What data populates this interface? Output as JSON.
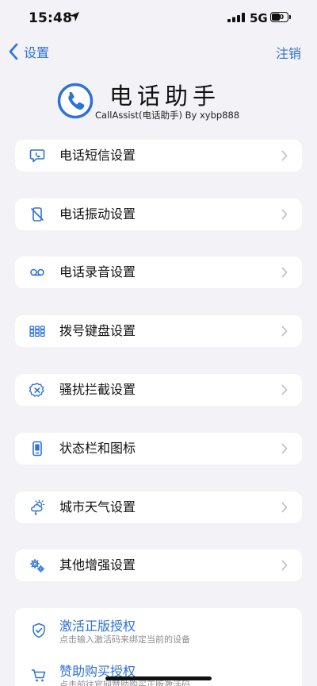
{
  "status_bar": {
    "time": "15:48",
    "network": "5G",
    "battery": "30"
  },
  "nav": {
    "back_label": "设置",
    "right_label": "注销"
  },
  "header": {
    "title": "电话助手",
    "subtitle": "CallAssist(电话助手) By xybp888",
    "icon": "phone-icon"
  },
  "menu": [
    {
      "label": "电话短信设置",
      "icon": "message-icon"
    },
    {
      "label": "电话振动设置",
      "icon": "vibrate-off-icon"
    },
    {
      "label": "电话录音设置",
      "icon": "voicemail-icon"
    },
    {
      "label": "拨号键盘设置",
      "icon": "dialpad-icon"
    },
    {
      "label": "骚扰拦截设置",
      "icon": "block-icon"
    },
    {
      "label": "状态栏和图标",
      "icon": "phone-screen-icon"
    },
    {
      "label": "城市天气设置",
      "icon": "weather-icon"
    },
    {
      "label": "其他增强设置",
      "icon": "gears-icon"
    }
  ],
  "license": [
    {
      "title": "激活正版授权",
      "subtitle": "点击输入激活码来绑定当前的设备",
      "icon": "shield-check-icon"
    },
    {
      "title": "赞助购买授权",
      "subtitle": "点击前往官网赞助购买正版激活码",
      "icon": "cart-icon"
    }
  ],
  "colors": {
    "accent": "#2e72d6",
    "background": "#f2f2f7",
    "card": "#ffffff",
    "secondary_text": "#8e8e93",
    "chevron": "#c4c4c7"
  }
}
